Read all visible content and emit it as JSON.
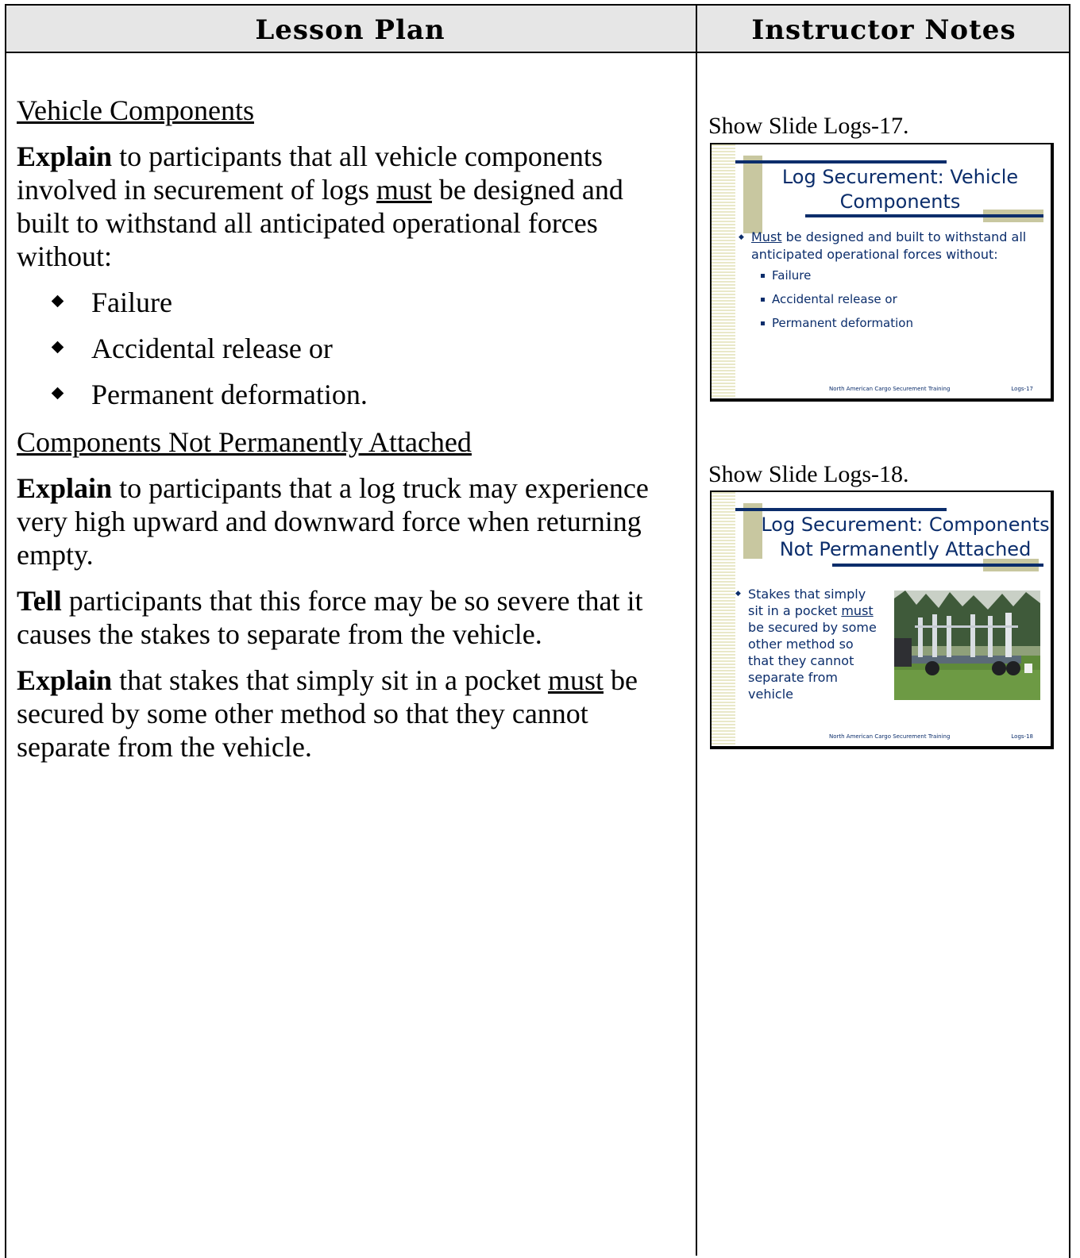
{
  "header": {
    "left": "Lesson Plan",
    "right": "Instructor Notes"
  },
  "lesson": {
    "section1_heading": "Vehicle Components",
    "p1_bold": "Explain",
    "p1_a": " to participants that all vehicle components involved in securement of logs ",
    "p1_u": "must",
    "p1_b": " be designed and built to withstand all anticipated operational forces without:",
    "bullets": [
      "Failure",
      "Accidental release or",
      "Permanent deformation."
    ],
    "section2_heading": "Components Not Permanently Attached",
    "p2_bold": "Explain",
    "p2_text": " to participants that a log truck may experience very high upward and downward force when returning empty.",
    "p3_bold": "Tell",
    "p3_text": " participants that this force may be so severe that it causes the stakes to separate from the vehicle.",
    "p4_bold": "Explain",
    "p4_a": " that stakes that simply sit in a pocket ",
    "p4_u": "must",
    "p4_b": " be secured by some other method so that they cannot separate from the vehicle."
  },
  "notes": {
    "show1": "Show Slide Logs-17.",
    "show2": "Show Slide Logs-18."
  },
  "slide17": {
    "title_line1": "Log Securement: Vehicle",
    "title_line2": "Components",
    "bullet_u": "Must",
    "bullet_rest": " be designed and built to withstand all anticipated operational forces without:",
    "subs": [
      "Failure",
      "Accidental release or",
      "Permanent deformation"
    ],
    "footer_center": "North American Cargo Securement Training",
    "footer_right": "Logs-17"
  },
  "slide18": {
    "title_line1": "Log Securement: Components",
    "title_line2": "Not Permanently Attached",
    "bullet_a": "Stakes that simply sit in a pocket ",
    "bullet_u": "must",
    "bullet_b": " be secured by some other method so that they cannot separate from vehicle",
    "footer_center": "North American Cargo Securement Training",
    "footer_right": "Logs-18"
  },
  "colors": {
    "slide_text": "#0b2d6b",
    "accent": "#c8c7a0",
    "header_bg": "#e6e6e6"
  }
}
